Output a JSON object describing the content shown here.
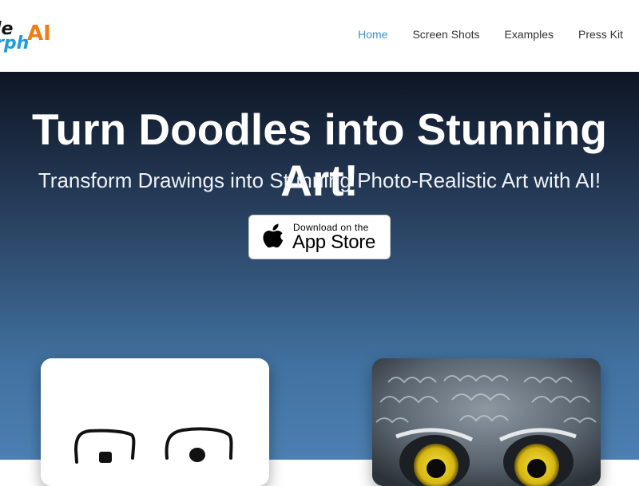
{
  "logo": {
    "line1": "le",
    "line2": "rph",
    "ai": "AI"
  },
  "nav": {
    "items": [
      {
        "label": "Home",
        "active": true
      },
      {
        "label": "Screen Shots",
        "active": false
      },
      {
        "label": "Examples",
        "active": false
      },
      {
        "label": "Press Kit",
        "active": false
      }
    ]
  },
  "hero": {
    "title": "Turn Doodles into Stunning Art!",
    "subtitle": "Transform Drawings into Stunning Photo-Realistic Art with AI!",
    "appstore": {
      "small_text": "Download on the",
      "large_text": "App Store",
      "icon": "apple-icon"
    }
  },
  "gallery": {
    "doodle_image": "doodle-eyes-drawing",
    "art_image": "owl-photo-realistic"
  },
  "colors": {
    "nav_active": "#3f8fc9",
    "logo_blue": "#1b9be0",
    "logo_orange": "#f07c14",
    "hero_top": "#0e1624",
    "hero_bottom": "#4c80b2"
  }
}
